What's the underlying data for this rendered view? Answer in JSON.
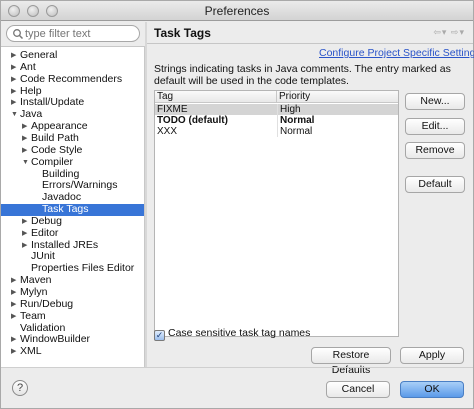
{
  "window": {
    "title": "Preferences"
  },
  "filter": {
    "placeholder": "type filter text"
  },
  "tree": [
    {
      "label": "General",
      "indent": 0,
      "twisty": "▶",
      "selected": false
    },
    {
      "label": "Ant",
      "indent": 0,
      "twisty": "▶",
      "selected": false
    },
    {
      "label": "Code Recommenders",
      "indent": 0,
      "twisty": "▶",
      "selected": false
    },
    {
      "label": "Help",
      "indent": 0,
      "twisty": "▶",
      "selected": false
    },
    {
      "label": "Install/Update",
      "indent": 0,
      "twisty": "▶",
      "selected": false
    },
    {
      "label": "Java",
      "indent": 0,
      "twisty": "▼",
      "selected": false
    },
    {
      "label": "Appearance",
      "indent": 1,
      "twisty": "▶",
      "selected": false
    },
    {
      "label": "Build Path",
      "indent": 1,
      "twisty": "▶",
      "selected": false
    },
    {
      "label": "Code Style",
      "indent": 1,
      "twisty": "▶",
      "selected": false
    },
    {
      "label": "Compiler",
      "indent": 1,
      "twisty": "▼",
      "selected": false
    },
    {
      "label": "Building",
      "indent": 2,
      "twisty": "",
      "selected": false
    },
    {
      "label": "Errors/Warnings",
      "indent": 2,
      "twisty": "",
      "selected": false
    },
    {
      "label": "Javadoc",
      "indent": 2,
      "twisty": "",
      "selected": false
    },
    {
      "label": "Task Tags",
      "indent": 2,
      "twisty": "",
      "selected": true
    },
    {
      "label": "Debug",
      "indent": 1,
      "twisty": "▶",
      "selected": false
    },
    {
      "label": "Editor",
      "indent": 1,
      "twisty": "▶",
      "selected": false
    },
    {
      "label": "Installed JREs",
      "indent": 1,
      "twisty": "▶",
      "selected": false
    },
    {
      "label": "JUnit",
      "indent": 1,
      "twisty": "",
      "selected": false
    },
    {
      "label": "Properties Files Editor",
      "indent": 1,
      "twisty": "",
      "selected": false
    },
    {
      "label": "Maven",
      "indent": 0,
      "twisty": "▶",
      "selected": false
    },
    {
      "label": "Mylyn",
      "indent": 0,
      "twisty": "▶",
      "selected": false
    },
    {
      "label": "Run/Debug",
      "indent": 0,
      "twisty": "▶",
      "selected": false
    },
    {
      "label": "Team",
      "indent": 0,
      "twisty": "▶",
      "selected": false
    },
    {
      "label": "Validation",
      "indent": 0,
      "twisty": "",
      "selected": false
    },
    {
      "label": "WindowBuilder",
      "indent": 0,
      "twisty": "▶",
      "selected": false
    },
    {
      "label": "XML",
      "indent": 0,
      "twisty": "▶",
      "selected": false
    }
  ],
  "page": {
    "title": "Task Tags",
    "link": "Configure Project Specific Settings...",
    "description": "Strings indicating tasks in Java comments. The entry marked as default will be used in the code templates.",
    "columns": [
      "Tag",
      "Priority"
    ],
    "rows": [
      {
        "tag": "FIXME",
        "priority": "High",
        "bold": false,
        "selected": true
      },
      {
        "tag": "TODO (default)",
        "priority": "Normal",
        "bold": true,
        "selected": false
      },
      {
        "tag": "XXX",
        "priority": "Normal",
        "bold": false,
        "selected": false
      }
    ],
    "buttons": {
      "new": "New...",
      "edit": "Edit...",
      "remove": "Remove",
      "default": "Default"
    },
    "checkbox": {
      "label": "Case sensitive task tag names",
      "checked": true
    },
    "restore_defaults": "Restore Defaults",
    "apply": "Apply"
  },
  "footer": {
    "help": "?",
    "cancel": "Cancel",
    "ok": "OK"
  },
  "colors": {
    "selection": "#3875d7",
    "link": "#2a54c9",
    "primary_button": "#5b9ae9"
  }
}
